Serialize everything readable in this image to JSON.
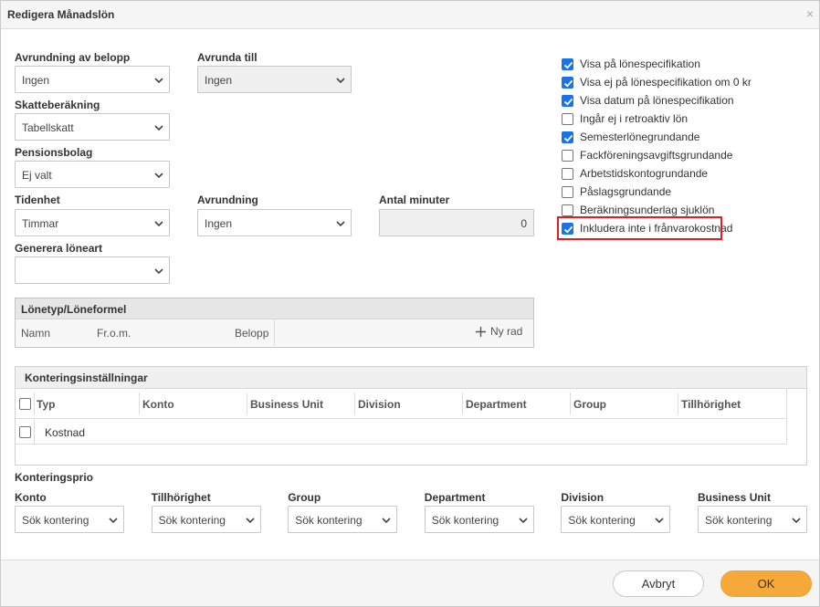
{
  "dialog": {
    "title": "Redigera Månadslön"
  },
  "fields": {
    "avrundning_belopp": {
      "label": "Avrundning av belopp",
      "value": "Ingen"
    },
    "avrunda_till": {
      "label": "Avrunda till",
      "value": "Ingen"
    },
    "skatteberakning": {
      "label": "Skatteberäkning",
      "value": "Tabellskatt"
    },
    "pensionsbolag": {
      "label": "Pensionsbolag",
      "value": "Ej valt"
    },
    "tidenhet": {
      "label": "Tidenhet",
      "value": "Timmar"
    },
    "avrundning": {
      "label": "Avrundning",
      "value": "Ingen"
    },
    "antal_minuter": {
      "label": "Antal minuter",
      "value": "0"
    },
    "generera_loneart": {
      "label": "Generera löneart",
      "value": ""
    }
  },
  "checkboxes": [
    {
      "label": "Visa på lönespecifikation",
      "checked": true
    },
    {
      "label": "Visa ej på lönespecifikation om 0 kr",
      "checked": true
    },
    {
      "label": "Visa datum på lönespecifikation",
      "checked": true
    },
    {
      "label": "Ingår ej i retroaktiv lön",
      "checked": false
    },
    {
      "label": "Semesterlönegrundande",
      "checked": true
    },
    {
      "label": "Fackföreningsavgiftsgrundande",
      "checked": false
    },
    {
      "label": "Arbetstidskontogrundande",
      "checked": false
    },
    {
      "label": "Påslagsgrundande",
      "checked": false
    },
    {
      "label": "Beräkningsunderlag sjuklön",
      "checked": false
    },
    {
      "label": "Inkludera inte i frånvarokostnad",
      "checked": true
    }
  ],
  "lonetyp": {
    "title": "Lönetyp/Löneformel",
    "columns": [
      "Namn",
      "Fr.o.m.",
      "Belopp"
    ],
    "add_row_label": "Ny rad"
  },
  "kontering": {
    "title": "Konteringsinställningar",
    "columns": [
      "Typ",
      "Konto",
      "Business Unit",
      "Division",
      "Department",
      "Group",
      "Tillhörighet"
    ],
    "rows": [
      {
        "typ": "Kostnad"
      }
    ]
  },
  "konteringsprio": {
    "title": "Konteringsprio",
    "items": [
      {
        "label": "Konto",
        "value": "Sök kontering"
      },
      {
        "label": "Tillhörighet",
        "value": "Sök kontering"
      },
      {
        "label": "Group",
        "value": "Sök kontering"
      },
      {
        "label": "Department",
        "value": "Sök kontering"
      },
      {
        "label": "Division",
        "value": "Sök kontering"
      },
      {
        "label": "Business Unit",
        "value": "Sök kontering"
      }
    ]
  },
  "footer": {
    "cancel_label": "Avbryt",
    "ok_label": "OK"
  },
  "colors": {
    "accent": "#1a73e8",
    "ok_button": "#f6a93b",
    "highlight": "#e02020"
  }
}
